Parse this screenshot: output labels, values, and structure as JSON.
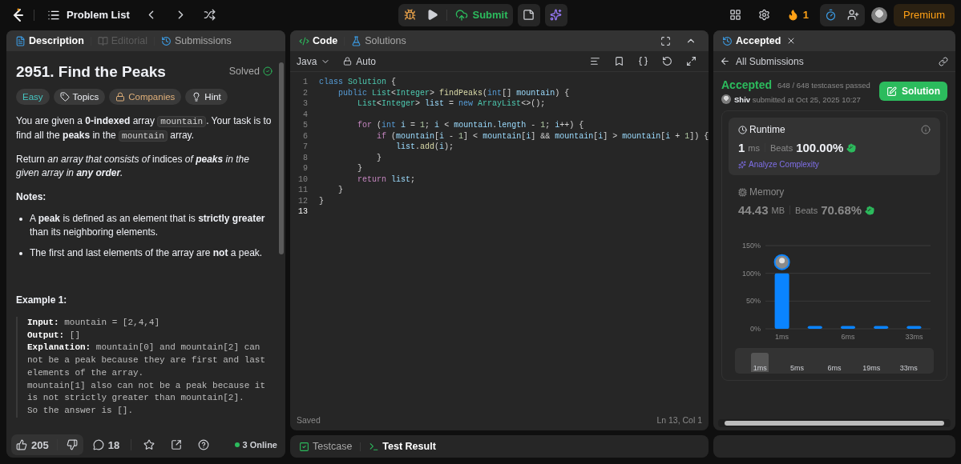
{
  "top_bar": {
    "problem_list": "Problem List",
    "submit": "Submit",
    "streak": "1",
    "premium": "Premium"
  },
  "left_tabs": [
    {
      "label": "Description",
      "selected": true,
      "disabled": false
    },
    {
      "label": "Editorial",
      "selected": false,
      "disabled": true
    },
    {
      "label": "Submissions",
      "selected": false,
      "disabled": false
    }
  ],
  "problem": {
    "title": "2951. Find the Peaks",
    "status": "Solved",
    "tags": [
      {
        "label": "Easy",
        "kind": "difficulty"
      },
      {
        "label": "Topics",
        "kind": "topics"
      },
      {
        "label": "Companies",
        "kind": "locked"
      },
      {
        "label": "Hint",
        "kind": "hint"
      }
    ],
    "paragraphs": [
      [
        {
          "kind": "text",
          "text": "You are given a **0-indexed** array "
        },
        {
          "kind": "code",
          "text": "mountain"
        },
        {
          "kind": "text",
          "text": ". Your task is to find all the **peaks** in the "
        },
        {
          "kind": "code",
          "text": "mountain"
        },
        {
          "kind": "text",
          "text": " array."
        }
      ],
      [
        {
          "kind": "text",
          "text": "Return "
        },
        {
          "kind": "italic",
          "text": "an array that consists of"
        },
        {
          "kind": "text",
          "text": " indices "
        },
        {
          "kind": "italic",
          "text": "of "
        },
        {
          "kind": "bolditalic",
          "text": "peaks"
        },
        {
          "kind": "italic",
          "text": " in the given array in "
        },
        {
          "kind": "bolditalic",
          "text": "any order"
        },
        {
          "kind": "italic",
          "text": "."
        }
      ]
    ],
    "notes_heading": "Notes:",
    "notes": [
      "A **peak** is defined as an element that is **strictly greater** than its neighboring elements.",
      "The first and last elements of the array are **not** a peak."
    ],
    "example": {
      "heading": "Example 1:",
      "lines": [
        {
          "label": "Input:",
          "text": "mountain = [2,4,4]"
        },
        {
          "label": "Output:",
          "text": "[]"
        },
        {
          "label": "Explanation:",
          "text": "mountain[0] and mountain[2] can not be a peak because they are first and last elements of the array."
        },
        {
          "text": "mountain[1] also can not be a peak because it is not strictly greater than mountain[2]."
        },
        {
          "text": "So the answer is []."
        }
      ]
    }
  },
  "footer": {
    "likes": "205",
    "comments": "18",
    "online": "3 Online"
  },
  "code_tabs": [
    {
      "label": "Code",
      "selected": true
    },
    {
      "label": "Solutions",
      "selected": false
    }
  ],
  "editor": {
    "language": "Java",
    "mode": "Auto",
    "status": "Saved",
    "cursor": "Ln 13, Col 1",
    "lines": [
      {
        "number": "1",
        "active": false,
        "tokens": [
          {
            "kind": "kw",
            "text": "class"
          },
          {
            "kind": "type",
            "text": " Solution"
          },
          {
            "kind": "p",
            "text": " {"
          }
        ]
      },
      {
        "number": "2",
        "active": false,
        "tokens": [
          {
            "kind": "kw",
            "text": "    public"
          },
          {
            "kind": "type",
            "text": " List"
          },
          {
            "kind": "p",
            "text": "<"
          },
          {
            "kind": "type",
            "text": "Integer"
          },
          {
            "kind": "p",
            "text": ">"
          },
          {
            "kind": "fn",
            "text": " findPeaks"
          },
          {
            "kind": "p",
            "text": "("
          },
          {
            "kind": "kw",
            "text": "int"
          },
          {
            "kind": "p",
            "text": "[]"
          },
          {
            "kind": "var",
            "text": " mountain"
          },
          {
            "kind": "p",
            "text": ") {"
          }
        ]
      },
      {
        "number": "3",
        "active": false,
        "tokens": [
          {
            "kind": "type",
            "text": "        List"
          },
          {
            "kind": "p",
            "text": "<"
          },
          {
            "kind": "type",
            "text": "Integer"
          },
          {
            "kind": "p",
            "text": ">"
          },
          {
            "kind": "var",
            "text": " list"
          },
          {
            "kind": "p",
            "text": " ="
          },
          {
            "kind": "kw",
            "text": " new"
          },
          {
            "kind": "type",
            "text": " ArrayList"
          },
          {
            "kind": "p",
            "text": "<>();"
          }
        ]
      },
      {
        "number": "4",
        "active": false
      },
      {
        "number": "5",
        "active": false,
        "tokens": [
          {
            "kind": "ctl",
            "text": "        for"
          },
          {
            "kind": "p",
            "text": " ("
          },
          {
            "kind": "kw",
            "text": "int"
          },
          {
            "kind": "var",
            "text": " i"
          },
          {
            "kind": "p",
            "text": " ="
          },
          {
            "kind": "num",
            "text": " 1"
          },
          {
            "kind": "p",
            "text": ";"
          },
          {
            "kind": "var",
            "text": " i"
          },
          {
            "kind": "p",
            "text": " <"
          },
          {
            "kind": "var",
            "text": " mountain"
          },
          {
            "kind": "p",
            "text": "."
          },
          {
            "kind": "var",
            "text": "length"
          },
          {
            "kind": "p",
            "text": " -"
          },
          {
            "kind": "num",
            "text": " 1"
          },
          {
            "kind": "p",
            "text": ";"
          },
          {
            "kind": "var",
            "text": " i"
          },
          {
            "kind": "p",
            "text": "++) {"
          }
        ]
      },
      {
        "number": "6",
        "active": false,
        "tokens": [
          {
            "kind": "ctl",
            "text": "            if"
          },
          {
            "kind": "p",
            "text": " ("
          },
          {
            "kind": "var",
            "text": "mountain"
          },
          {
            "kind": "p",
            "text": "["
          },
          {
            "kind": "var",
            "text": "i"
          },
          {
            "kind": "p",
            "text": " -"
          },
          {
            "kind": "num",
            "text": " 1"
          },
          {
            "kind": "p",
            "text": "] <"
          },
          {
            "kind": "var",
            "text": " mountain"
          },
          {
            "kind": "p",
            "text": "["
          },
          {
            "kind": "var",
            "text": "i"
          },
          {
            "kind": "p",
            "text": "] &&"
          },
          {
            "kind": "var",
            "text": " mountain"
          },
          {
            "kind": "p",
            "text": "["
          },
          {
            "kind": "var",
            "text": "i"
          },
          {
            "kind": "p",
            "text": "] >"
          },
          {
            "kind": "var",
            "text": " mountain"
          },
          {
            "kind": "p",
            "text": "["
          },
          {
            "kind": "var",
            "text": "i"
          },
          {
            "kind": "p",
            "text": " +"
          },
          {
            "kind": "num",
            "text": " 1"
          },
          {
            "kind": "p",
            "text": "]) {"
          }
        ]
      },
      {
        "number": "7",
        "active": false,
        "tokens": [
          {
            "kind": "var",
            "text": "                list"
          },
          {
            "kind": "p",
            "text": "."
          },
          {
            "kind": "fn",
            "text": "add"
          },
          {
            "kind": "p",
            "text": "("
          },
          {
            "kind": "var",
            "text": "i"
          },
          {
            "kind": "p",
            "text": ");"
          }
        ]
      },
      {
        "number": "8",
        "active": false,
        "tokens": [
          {
            "kind": "p",
            "text": "            }"
          }
        ]
      },
      {
        "number": "9",
        "active": false,
        "tokens": [
          {
            "kind": "p",
            "text": "        }"
          }
        ]
      },
      {
        "number": "10",
        "active": false,
        "tokens": [
          {
            "kind": "ctl",
            "text": "        return"
          },
          {
            "kind": "var",
            "text": " list"
          },
          {
            "kind": "p",
            "text": ";"
          }
        ]
      },
      {
        "number": "11",
        "active": false,
        "tokens": [
          {
            "kind": "p",
            "text": "    }"
          }
        ]
      },
      {
        "number": "12",
        "active": false,
        "tokens": [
          {
            "kind": "p",
            "text": "}"
          }
        ]
      },
      {
        "number": "13",
        "active": true
      }
    ]
  },
  "bottom_tabs": [
    {
      "label": "Testcase",
      "selected": false
    },
    {
      "label": "Test Result",
      "selected": true
    }
  ],
  "result": {
    "tab": "Accepted",
    "back": "All Submissions",
    "verdict": "Accepted",
    "passed": "648 / 648 testcases passed",
    "user": "Shiv",
    "submitted": "submitted at Oct 25, 2025 10:27",
    "solution_button": "Solution",
    "metrics": [
      {
        "kind": "runtime",
        "label": "Runtime",
        "value": "1",
        "unit": "ms",
        "beats_label": "Beats",
        "beats": "100.00%",
        "selected": true,
        "link": "Analyze Complexity"
      },
      {
        "kind": "memory",
        "label": "Memory",
        "value": "44.43",
        "unit": "MB",
        "beats_label": "Beats",
        "beats": "70.68%",
        "selected": false
      }
    ],
    "chart_data": {
      "type": "bar",
      "categories": [
        "1ms",
        null,
        "6ms",
        null,
        "33ms"
      ],
      "series": [
        {
          "color": "#0a84ff",
          "values": [
            100,
            5,
            5,
            5,
            5
          ]
        }
      ],
      "ylim": [
        0,
        150
      ],
      "yticks": [
        {
          "value": 0,
          "label": "0%"
        },
        {
          "value": 50,
          "label": "50%"
        },
        {
          "value": 100,
          "label": "100%"
        },
        {
          "value": 150,
          "label": "150%"
        }
      ]
    },
    "range": [
      {
        "label": "1ms",
        "selected": true
      },
      {
        "label": "5ms",
        "selected": false
      },
      {
        "label": "6ms",
        "selected": false
      },
      {
        "label": "19ms",
        "selected": false
      },
      {
        "label": "33ms",
        "selected": false
      }
    ]
  }
}
